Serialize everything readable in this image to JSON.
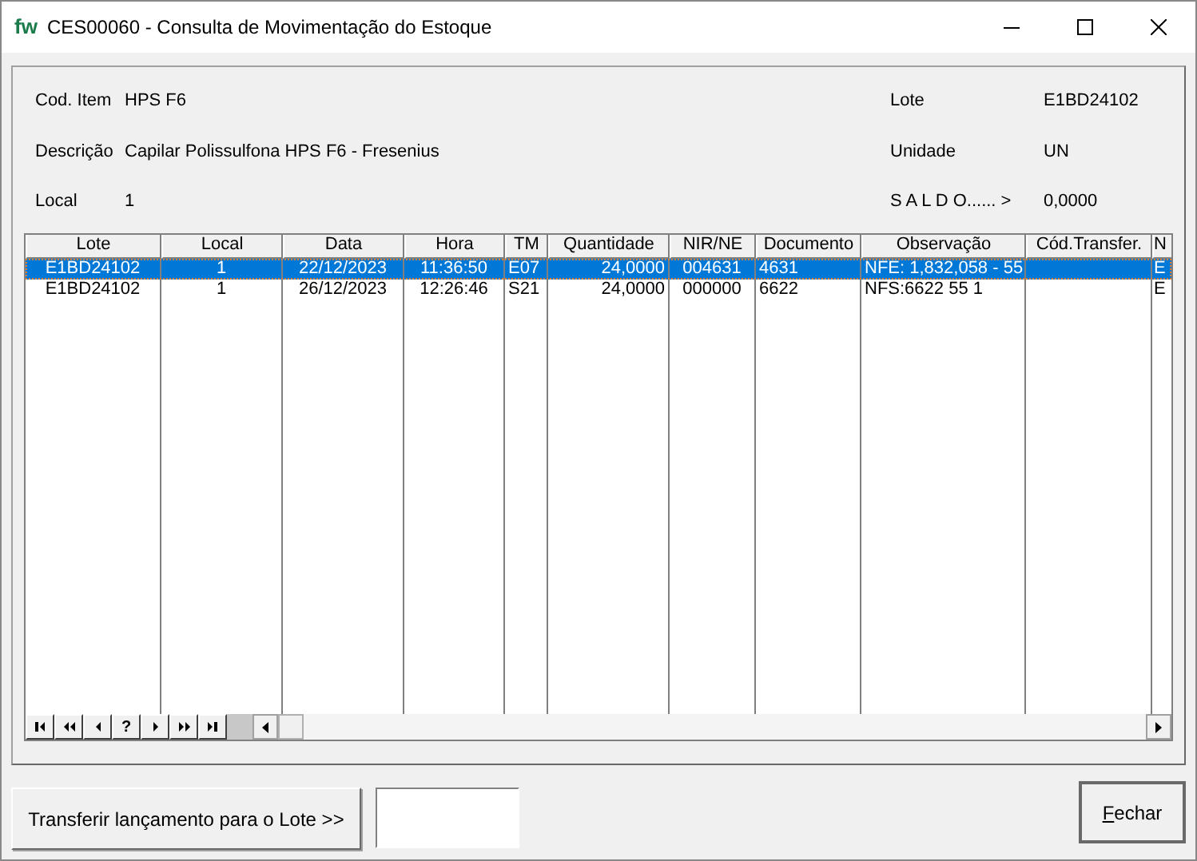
{
  "window": {
    "logo": "fw",
    "title": "CES00060 - Consulta de Movimentação do Estoque"
  },
  "header": {
    "left": [
      {
        "label": "Cod. Item",
        "value": "HPS F6"
      },
      {
        "label": "Descrição",
        "value": "Capilar Polissulfona HPS F6 - Fresenius"
      },
      {
        "label": "Local",
        "value": "1"
      }
    ],
    "right": [
      {
        "label": "Lote",
        "value": "E1BD24102"
      },
      {
        "label": "Unidade",
        "value": "UN"
      },
      {
        "label": "S A L D O...... >",
        "value": "0,0000"
      }
    ]
  },
  "table": {
    "columns": [
      "Lote",
      "Local",
      "Data",
      "Hora",
      "TM",
      "Quantidade",
      "NIR/NE",
      "Documento",
      "Observação",
      "Cód.Transfer.",
      "N"
    ],
    "rows": [
      {
        "selected": true,
        "cells": [
          "E1BD24102",
          "1",
          "22/12/2023",
          "11:36:50",
          "E07",
          "24,0000",
          "004631",
          "4631",
          "NFE: 1,832,058 - 55",
          "",
          "E"
        ]
      },
      {
        "selected": false,
        "cells": [
          "E1BD24102",
          "1",
          "26/12/2023",
          "12:26:46",
          "S21",
          "24,0000",
          "000000",
          "6622",
          "NFS:6622 55 1",
          "",
          "E"
        ]
      }
    ]
  },
  "navigator": {
    "buttons": [
      {
        "kind": "first"
      },
      {
        "kind": "prevpage"
      },
      {
        "kind": "prev"
      },
      {
        "kind": "help",
        "label": "?"
      },
      {
        "kind": "next"
      },
      {
        "kind": "nextpage"
      },
      {
        "kind": "last"
      }
    ]
  },
  "buttons": {
    "transfer": "Transferir lançamento para o Lote >>",
    "close": "Fechar"
  }
}
